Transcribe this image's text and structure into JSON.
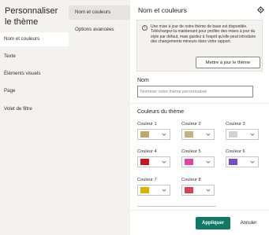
{
  "left_panel": {
    "title": "Personnaliser le thème",
    "items": [
      {
        "label": "Nom et couleurs",
        "active": true
      },
      {
        "label": "Texte",
        "active": false
      },
      {
        "label": "Éléments visuels",
        "active": false
      },
      {
        "label": "Page",
        "active": false
      },
      {
        "label": "Volet de filtre",
        "active": false
      }
    ]
  },
  "mid_panel": {
    "items": [
      {
        "label": "Nom et couleurs",
        "active": true
      },
      {
        "label": "Options avancées",
        "active": false
      }
    ]
  },
  "main": {
    "title": "Nom et couleurs",
    "settings_icon": "gear-icon",
    "info": {
      "icon": "info-icon",
      "text": "Une mise à jour de notre thème de base est disponible. Téléchargez-la maintenant pour profiter des mises à jour du style par défaut, mais gardez à l'esprit qu'elle peut introduire des changements mineurs dans votre rapport.",
      "button_label": "Mettre à jour le thème"
    },
    "name_section": {
      "label": "Nom",
      "value": "",
      "placeholder": "Nommer votre thème personnalisé"
    },
    "colors_section": {
      "label": "Couleurs du thème",
      "colors": [
        {
          "label": "Couleur 1",
          "hex": "#c5a66a"
        },
        {
          "label": "Couleur 2",
          "hex": "#c8b083"
        },
        {
          "label": "Couleur 3",
          "hex": "#d2d2d2"
        },
        {
          "label": "Couleur 4",
          "hex": "#c4161c"
        },
        {
          "label": "Couleur 5",
          "hex": "#e044a7"
        },
        {
          "label": "Couleur 6",
          "hex": "#744ec2"
        },
        {
          "label": "Couleur 7",
          "hex": "#d9b300"
        },
        {
          "label": "Couleur 8",
          "hex": "#d64550"
        }
      ]
    },
    "footer": {
      "apply_label": "Appliquer",
      "cancel_label": "Annuler"
    }
  }
}
